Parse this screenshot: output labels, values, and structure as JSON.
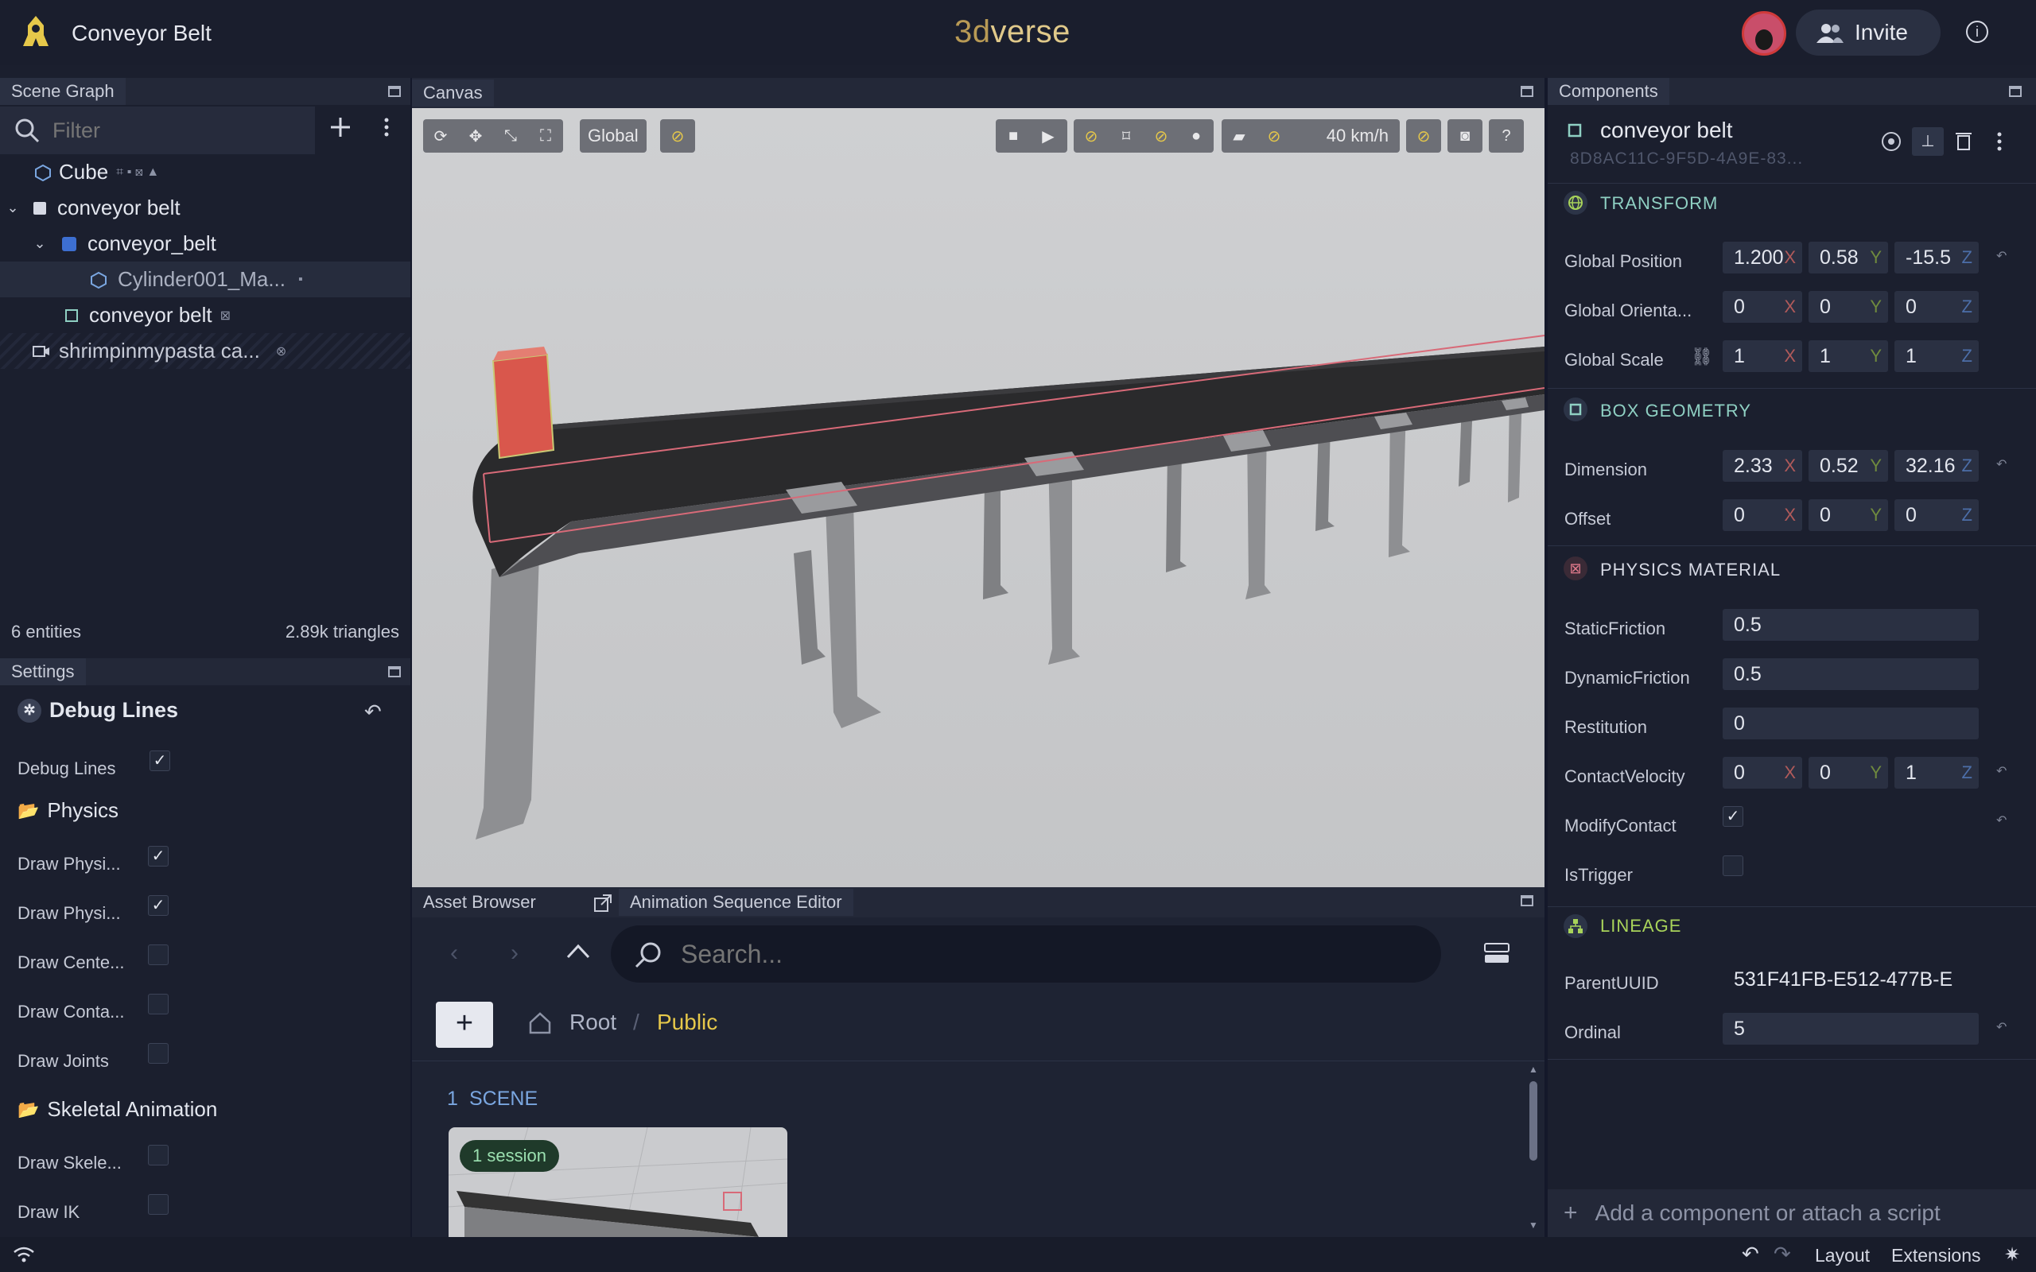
{
  "app": {
    "title": "Conveyor Belt",
    "brand_a": "3d",
    "brand_b": "verse",
    "invite": "Invite"
  },
  "scene_graph": {
    "header": "Scene Graph",
    "filter_placeholder": "Filter",
    "items": [
      {
        "label": "Cube"
      },
      {
        "label": "conveyor belt"
      },
      {
        "label": "conveyor_belt"
      },
      {
        "label": "Cylinder001_Ma..."
      },
      {
        "label": "conveyor belt"
      },
      {
        "label": "shrimpinmypasta ca..."
      }
    ],
    "entities": "6 entities",
    "triangles": "2.89k triangles"
  },
  "settings": {
    "header": "Settings",
    "debug_lines_title": "Debug Lines",
    "debug_lines_label": "Debug Lines",
    "physics_title": "Physics",
    "physics_rows": [
      "Draw Physi...",
      "Draw Physi...",
      "Draw Cente...",
      "Draw Conta...",
      "Draw Joints"
    ],
    "skeletal_title": "Skeletal Animation",
    "skeletal_rows": [
      "Draw Skele...",
      "Draw IK"
    ]
  },
  "canvas": {
    "header": "Canvas",
    "space_mode": "Global",
    "speed": "40 km/h"
  },
  "components": {
    "header": "Components",
    "entity_name": "conveyor belt",
    "entity_uuid": "8D8AC11C-9F5D-4A9E-83...",
    "transform": {
      "title": "TRANSFORM",
      "position_label": "Global Position",
      "position": [
        "1.200",
        "0.58",
        "-15.5"
      ],
      "orientation_label": "Global Orienta...",
      "orientation": [
        "0",
        "0",
        "0"
      ],
      "scale_label": "Global Scale",
      "scale": [
        "1",
        "1",
        "1"
      ]
    },
    "box_geometry": {
      "title": "BOX GEOMETRY",
      "dimension_label": "Dimension",
      "dimension": [
        "2.33",
        "0.52",
        "32.16"
      ],
      "offset_label": "Offset",
      "offset": [
        "0",
        "0",
        "0"
      ]
    },
    "physics_material": {
      "title": "PHYSICS MATERIAL",
      "static_label": "StaticFriction",
      "static": "0.5",
      "dynamic_label": "DynamicFriction",
      "dynamic": "0.5",
      "restitution_label": "Restitution",
      "restitution": "0",
      "contact_velocity_label": "ContactVelocity",
      "contact_velocity": [
        "0",
        "0",
        "1"
      ],
      "modify_contact_label": "ModifyContact",
      "is_trigger_label": "IsTrigger"
    },
    "lineage": {
      "title": "LINEAGE",
      "parent_label": "ParentUUID",
      "parent": "531F41FB-E512-477B-E",
      "ordinal_label": "Ordinal",
      "ordinal": "5"
    },
    "axes": [
      "X",
      "Y",
      "Z"
    ],
    "add_component": "Add a component or attach a script"
  },
  "asset_browser": {
    "tab1": "Asset Browser",
    "tab2": "Animation Sequence Editor",
    "search_placeholder": "Search...",
    "crumb_root": "Root",
    "crumb_sep": "/",
    "crumb_public": "Public",
    "scene_count": "1",
    "scene_label": "SCENE",
    "session_badge": "1 session"
  },
  "footer": {
    "layout": "Layout",
    "extensions": "Extensions"
  },
  "colors": {
    "accent_gold": "#e6c84a",
    "teal": "#8fd0c3",
    "bg": "#1b1f2e"
  }
}
